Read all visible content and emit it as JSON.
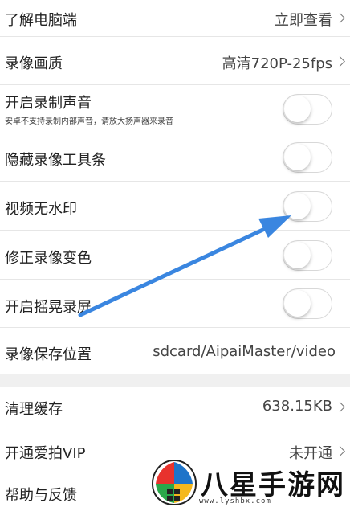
{
  "settings": {
    "rows": [
      {
        "label": "了解电脑端",
        "value": "立即查看"
      },
      {
        "label": "录像画质",
        "value": "高清720P-25fps"
      },
      {
        "label": "开启录制声音",
        "sublabel": "安卓不支持录制内部声音，请放大扬声器来录音",
        "toggle": false
      },
      {
        "label": "隐藏录像工具条",
        "toggle": false
      },
      {
        "label": "视频无水印",
        "toggle": false
      },
      {
        "label": "修正录像变色",
        "toggle": false
      },
      {
        "label": "开启摇晃录屏",
        "toggle": false
      },
      {
        "label": "录像保存位置",
        "value": "sdcard/AipaiMaster/video"
      },
      {
        "label": "清理缓存",
        "value": "638.15KB"
      },
      {
        "label": "开通爱拍VIP",
        "value": "未开通"
      },
      {
        "label": "帮助与反馈"
      }
    ]
  },
  "annotation": {
    "arrow_color": "#3a86e0"
  },
  "watermark": {
    "text": "八星手游网",
    "url": "www.lyshbx.com"
  }
}
